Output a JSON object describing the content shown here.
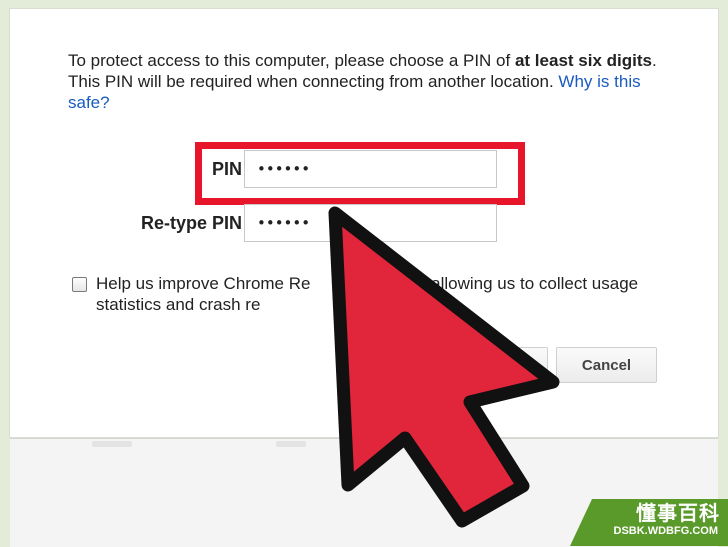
{
  "dialog": {
    "description_start": "To protect access to this computer, please choose a PIN of ",
    "description_bold": "at least six digits",
    "description_end": ". This PIN will be required when connecting from another location. ",
    "why_safe_link": "Why is this safe?",
    "pin_label": "PIN",
    "pin_value": "••••••",
    "retype_label": "Re-type PIN",
    "retype_value": "••••••",
    "checkbox_text_visible_start": "Help us improve Chrome Re",
    "checkbox_text_visible_end": "by allowing us to collect usage statistics and crash re",
    "checkbox_checked": false,
    "cancel_label": "Cancel"
  },
  "annotation": {
    "highlight_color": "#e8162a",
    "arrow_color": "#e1253a",
    "arrow_outline_color": "#111111",
    "arrow_icon": "pointer-arrow-icon"
  },
  "watermark": {
    "name": "懂事百科",
    "url": "DSBK.WDBFG.COM",
    "color": "#5a9a2a"
  }
}
